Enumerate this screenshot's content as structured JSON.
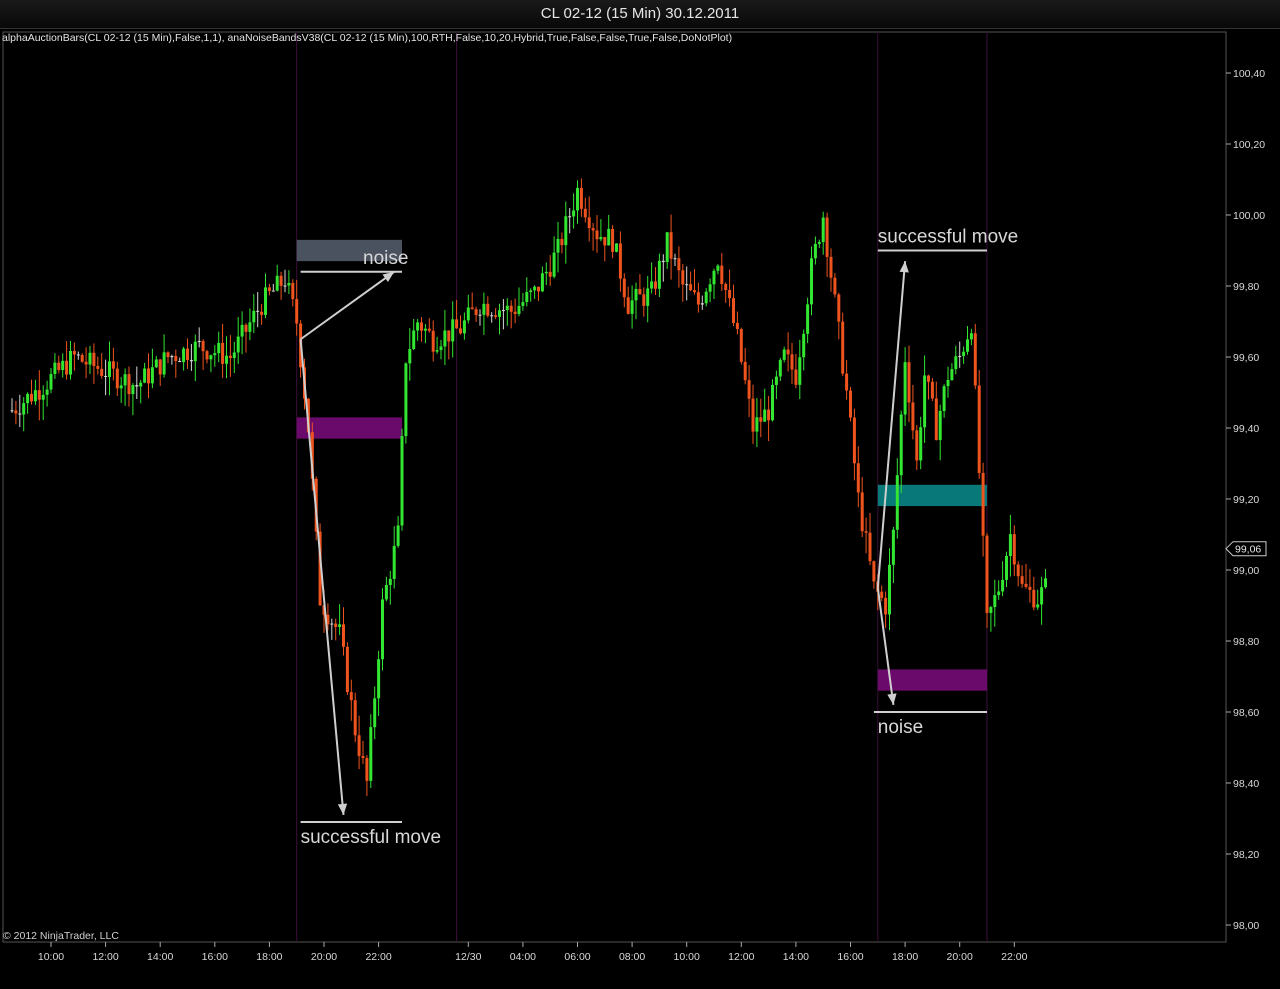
{
  "window": {
    "title": "CL 02-12 (15 Min)  30.12.2011"
  },
  "indicators_label": "alphaAuctionBars(CL 02-12 (15 Min),False,1,1), anaNoiseBandsV38(CL 02-12 (15 Min),100,RTH,False,10,20,Hybrid,True,False,False,True,False,DoNotPlot)",
  "copyright": "© 2012 NinjaTrader, LLC",
  "colors": {
    "up": "#32e632",
    "down": "#f0541e",
    "neutral": "#d8d8d8",
    "band_gray": "#4a5260",
    "band_purple": "#6a0a6a",
    "band_teal": "#087878",
    "session_line": "#3a0f3a"
  },
  "chart_data": {
    "type": "candlestick",
    "instrument": "CL 02-12",
    "interval": "15 Min",
    "date": "30.12.2011",
    "ylim": [
      97.95,
      100.5
    ],
    "y_ticks": [
      "98,00",
      "98,20",
      "98,40",
      "98,60",
      "98,80",
      "99,00",
      "99,20",
      "99,40",
      "99,60",
      "99,80",
      "100,00",
      "100,20",
      "100,40"
    ],
    "x_ticks": [
      "10:00",
      "12:00",
      "14:00",
      "16:00",
      "18:00",
      "20:00",
      "22:00",
      "12/30",
      "04:00",
      "06:00",
      "08:00",
      "10:00",
      "12:00",
      "14:00",
      "16:00",
      "18:00",
      "20:00",
      "22:00"
    ],
    "last_price": "99,06",
    "session_bounds_bar_index": [
      73,
      114,
      222,
      250
    ],
    "bands": [
      {
        "name": "noise",
        "x_bars": [
          73,
          100
        ],
        "y": [
          99.87,
          99.93
        ],
        "color": "band_gray"
      },
      {
        "name": "",
        "x_bars": [
          73,
          100
        ],
        "y": [
          99.37,
          99.43
        ],
        "color": "band_purple"
      },
      {
        "name": "",
        "x_bars": [
          222,
          250
        ],
        "y": [
          99.18,
          99.24
        ],
        "color": "band_teal"
      },
      {
        "name": "",
        "x_bars": [
          222,
          250
        ],
        "y": [
          98.66,
          98.72
        ],
        "color": "band_purple"
      }
    ],
    "levels": [
      {
        "y": 99.84,
        "x_bars": [
          74,
          100
        ]
      },
      {
        "y": 98.29,
        "x_bars": [
          74,
          100
        ]
      },
      {
        "y": 99.9,
        "x_bars": [
          222,
          250
        ]
      },
      {
        "y": 98.6,
        "x_bars": [
          221,
          250
        ]
      }
    ],
    "annotations": [
      {
        "text": "noise",
        "x_bar": 90,
        "y": 99.84,
        "anchor": "above"
      },
      {
        "text": "successful move",
        "x_bar": 74,
        "y": 98.29,
        "anchor": "below"
      },
      {
        "text": "successful move",
        "x_bar": 222,
        "y": 99.9,
        "anchor": "above"
      },
      {
        "text": "noise",
        "x_bar": 222,
        "y": 98.6,
        "anchor": "below"
      }
    ],
    "arrows": [
      {
        "from": [
          74,
          99.65
        ],
        "to": [
          98,
          99.84
        ]
      },
      {
        "from": [
          74,
          99.65
        ],
        "to": [
          85,
          98.31
        ]
      },
      {
        "from": [
          222,
          98.95
        ],
        "to": [
          229,
          99.87
        ]
      },
      {
        "from": [
          222,
          98.95
        ],
        "to": [
          226,
          98.62
        ]
      }
    ],
    "anchors": [
      [
        0,
        99.45
      ],
      [
        8,
        99.52
      ],
      [
        16,
        99.6
      ],
      [
        24,
        99.56
      ],
      [
        32,
        99.52
      ],
      [
        40,
        99.6
      ],
      [
        48,
        99.63
      ],
      [
        56,
        99.6
      ],
      [
        64,
        99.75
      ],
      [
        70,
        99.82
      ],
      [
        73,
        99.7
      ],
      [
        76,
        99.4
      ],
      [
        79,
        98.92
      ],
      [
        84,
        98.82
      ],
      [
        88,
        98.55
      ],
      [
        91,
        98.4
      ],
      [
        95,
        98.9
      ],
      [
        99,
        99.1
      ],
      [
        101,
        99.6
      ],
      [
        104,
        99.7
      ],
      [
        108,
        99.65
      ],
      [
        115,
        99.68
      ],
      [
        120,
        99.75
      ],
      [
        128,
        99.73
      ],
      [
        134,
        99.78
      ],
      [
        140,
        99.9
      ],
      [
        145,
        100.07
      ],
      [
        150,
        99.95
      ],
      [
        154,
        99.93
      ],
      [
        158,
        99.75
      ],
      [
        164,
        99.78
      ],
      [
        168,
        99.92
      ],
      [
        172,
        99.8
      ],
      [
        176,
        99.75
      ],
      [
        181,
        99.88
      ],
      [
        186,
        99.65
      ],
      [
        190,
        99.4
      ],
      [
        194,
        99.45
      ],
      [
        198,
        99.6
      ],
      [
        201,
        99.55
      ],
      [
        205,
        99.85
      ],
      [
        208,
        100.0
      ],
      [
        211,
        99.75
      ],
      [
        214,
        99.5
      ],
      [
        217,
        99.2
      ],
      [
        221,
        98.95
      ],
      [
        224,
        98.9
      ],
      [
        226,
        99.1
      ],
      [
        229,
        99.6
      ],
      [
        232,
        99.3
      ],
      [
        234,
        99.55
      ],
      [
        237,
        99.4
      ],
      [
        240,
        99.55
      ],
      [
        243,
        99.6
      ],
      [
        246,
        99.7
      ],
      [
        250,
        98.85
      ],
      [
        253,
        98.95
      ],
      [
        256,
        99.1
      ],
      [
        259,
        98.95
      ],
      [
        263,
        98.92
      ],
      [
        265,
        98.95
      ]
    ]
  }
}
